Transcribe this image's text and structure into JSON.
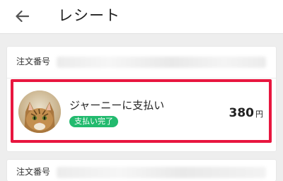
{
  "header": {
    "title": "レシート",
    "back_icon": "arrow-left-icon"
  },
  "receipts": [
    {
      "order_label": "注文番号",
      "payment": {
        "title": "ジャーニーに支払い",
        "status": "支払い完了",
        "amount": "380",
        "currency": "円",
        "avatar": "cat-avatar"
      }
    },
    {
      "order_label": "注文番号"
    }
  ],
  "colors": {
    "highlight": "#e8163f",
    "status_badge": "#22ba6e",
    "background": "#eeeeee"
  }
}
